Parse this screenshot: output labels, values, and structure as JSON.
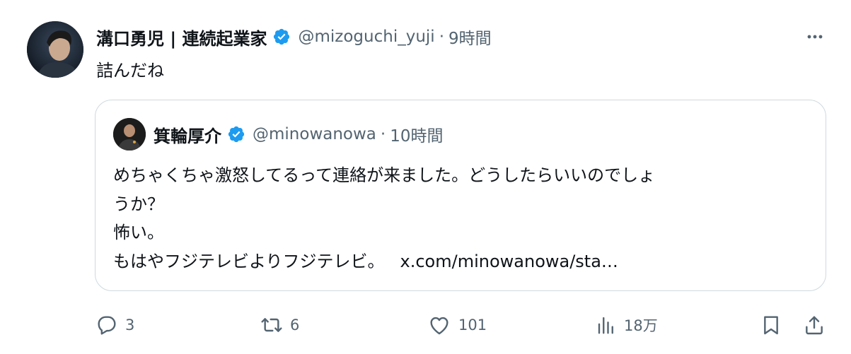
{
  "tweet": {
    "author_name": "溝口勇児 | 連続起業家",
    "author_handle": "@mizoguchi_yuji",
    "separator": "·",
    "time": "9時間",
    "text": "詰んだね",
    "avatar_icon": "user-avatar",
    "verified_icon": "verified-badge-icon",
    "more_icon": "more-options-icon"
  },
  "quote": {
    "author_name": "箕輪厚介",
    "author_handle": "@minowanowa",
    "separator": "·",
    "time": "10時間",
    "lines": [
      "めちゃくちゃ激怒してるって連絡が来ました。どうしたらいいのでしょ",
      "うか？",
      "怖い。",
      "もはやフジテレビよりフジテレビ。"
    ],
    "link": "x.com/minowanowa/sta…"
  },
  "actions": {
    "reply_count": "3",
    "repost_count": "6",
    "like_count": "101",
    "views_count": "18万",
    "icons": [
      "reply-icon",
      "repost-icon",
      "like-icon",
      "views-icon",
      "bookmark-icon",
      "share-icon"
    ]
  },
  "colors": {
    "text_primary": "#0f1419",
    "text_secondary": "#536471",
    "verified_blue": "#1d9bf0",
    "border": "#cfd9de"
  }
}
